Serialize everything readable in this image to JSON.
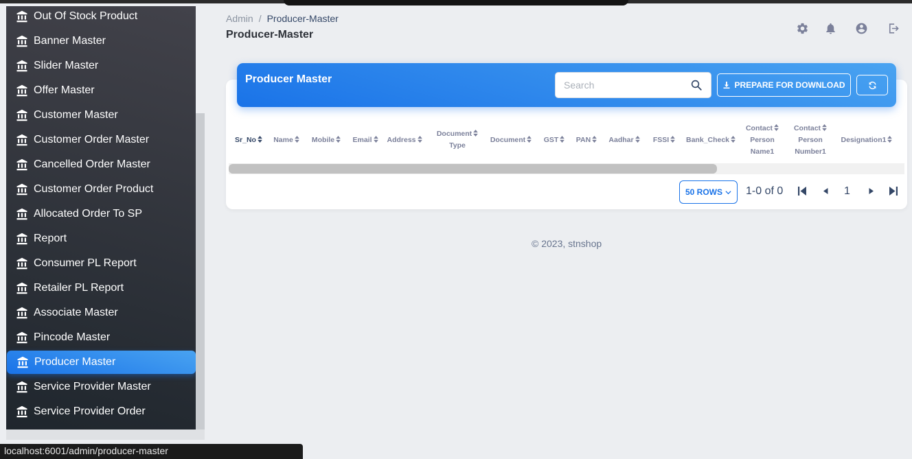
{
  "sidebar": {
    "items": [
      {
        "label": "Out Of Stock Product",
        "icon": "bank-icon"
      },
      {
        "label": "Banner Master",
        "icon": "bank-icon"
      },
      {
        "label": "Slider Master",
        "icon": "bank-icon"
      },
      {
        "label": "Offer Master",
        "icon": "bank-icon"
      },
      {
        "label": "Customer Master",
        "icon": "bank-icon"
      },
      {
        "label": "Customer Order Master",
        "icon": "bank-icon"
      },
      {
        "label": "Cancelled Order Master",
        "icon": "bank-icon"
      },
      {
        "label": "Customer Order Product",
        "icon": "bank-icon"
      },
      {
        "label": "Allocated Order To SP",
        "icon": "bank-icon"
      },
      {
        "label": "Report",
        "icon": "bank-icon"
      },
      {
        "label": "Consumer PL Report",
        "icon": "bank-icon"
      },
      {
        "label": "Retailer PL Report",
        "icon": "bank-icon"
      },
      {
        "label": "Associate Master",
        "icon": "bank-icon"
      },
      {
        "label": "Pincode Master",
        "icon": "bank-icon"
      },
      {
        "label": "Producer Master",
        "icon": "bank-icon",
        "active": true
      },
      {
        "label": "Service Provider Master",
        "icon": "bank-icon"
      },
      {
        "label": "Service Provider Order",
        "icon": "bank-icon"
      }
    ]
  },
  "breadcrumb": {
    "root": "Admin",
    "separator": "/",
    "current": "Producer-Master"
  },
  "page_title": "Producer-Master",
  "header_icons": [
    "gear-icon",
    "bell-icon",
    "user-circle-icon",
    "logout-icon"
  ],
  "card": {
    "title": "Producer Master",
    "search_placeholder": "Search",
    "download_label": "PREPARE FOR DOWNLOAD",
    "refresh_icon": "refresh-icon"
  },
  "table": {
    "columns": [
      {
        "lines": [
          "Sr_No"
        ]
      },
      {
        "lines": [
          "Name"
        ]
      },
      {
        "lines": [
          "Mobile"
        ]
      },
      {
        "lines": [
          "Email"
        ]
      },
      {
        "lines": [
          "Address"
        ]
      },
      {
        "lines": [
          "Document",
          "Type"
        ]
      },
      {
        "lines": [
          "Document"
        ]
      },
      {
        "lines": [
          "GST"
        ]
      },
      {
        "lines": [
          "PAN"
        ]
      },
      {
        "lines": [
          "Aadhar"
        ]
      },
      {
        "lines": [
          "FSSI"
        ]
      },
      {
        "lines": [
          "Bank_Check"
        ]
      },
      {
        "lines": [
          "Contact",
          "Person",
          "Name1"
        ]
      },
      {
        "lines": [
          "Contact",
          "Person",
          "Number1"
        ]
      },
      {
        "lines": [
          "Designation1"
        ]
      }
    ]
  },
  "pagination": {
    "rows_label": "50 ROWS",
    "range": "1-0 of 0",
    "page": "1"
  },
  "footer": "© 2023, stnshop",
  "status_url": "localhost:6001/admin/producer-master",
  "colors": {
    "accent": "#1a73e8",
    "accent_light": "#49a3f1",
    "sidebar_dark": "#1f262d",
    "background": "#eceef1"
  }
}
